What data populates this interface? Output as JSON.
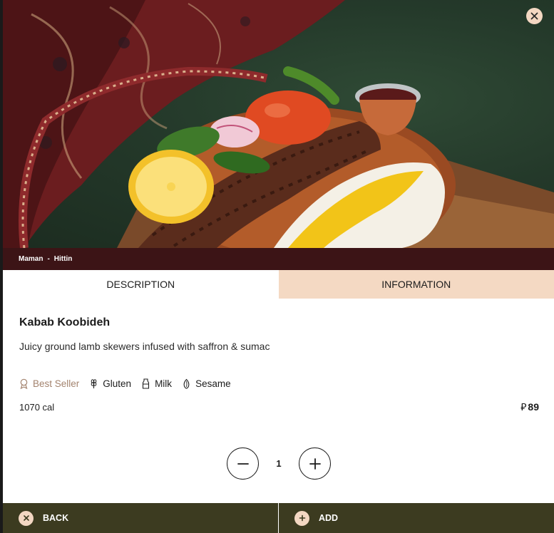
{
  "breadcrumb": {
    "restaurant": "Maman",
    "separator": "-",
    "branch": "Hittin"
  },
  "tabs": [
    {
      "label": "DESCRIPTION",
      "active": true
    },
    {
      "label": "INFORMATION",
      "active": false
    }
  ],
  "item": {
    "name": "Kabab Koobideh",
    "description": "Juicy ground lamb skewers infused with saffron & sumac",
    "calories": "1070 cal",
    "currency_symbol": "⃁",
    "price": "89"
  },
  "tags": [
    {
      "label": "Best Seller",
      "icon": "award-icon"
    },
    {
      "label": "Gluten",
      "icon": "wheat-icon"
    },
    {
      "label": "Milk",
      "icon": "milk-bottle-icon"
    },
    {
      "label": "Sesame",
      "icon": "sesame-icon"
    }
  ],
  "quantity": {
    "value": "1"
  },
  "footer": {
    "back_label": "BACK",
    "add_label": "ADD"
  },
  "colors": {
    "accent_peach": "#f3d7c2",
    "breadcrumb_bg": "#3c1416",
    "footer_bg": "#3c3b20",
    "best_seller": "#a3836e"
  }
}
